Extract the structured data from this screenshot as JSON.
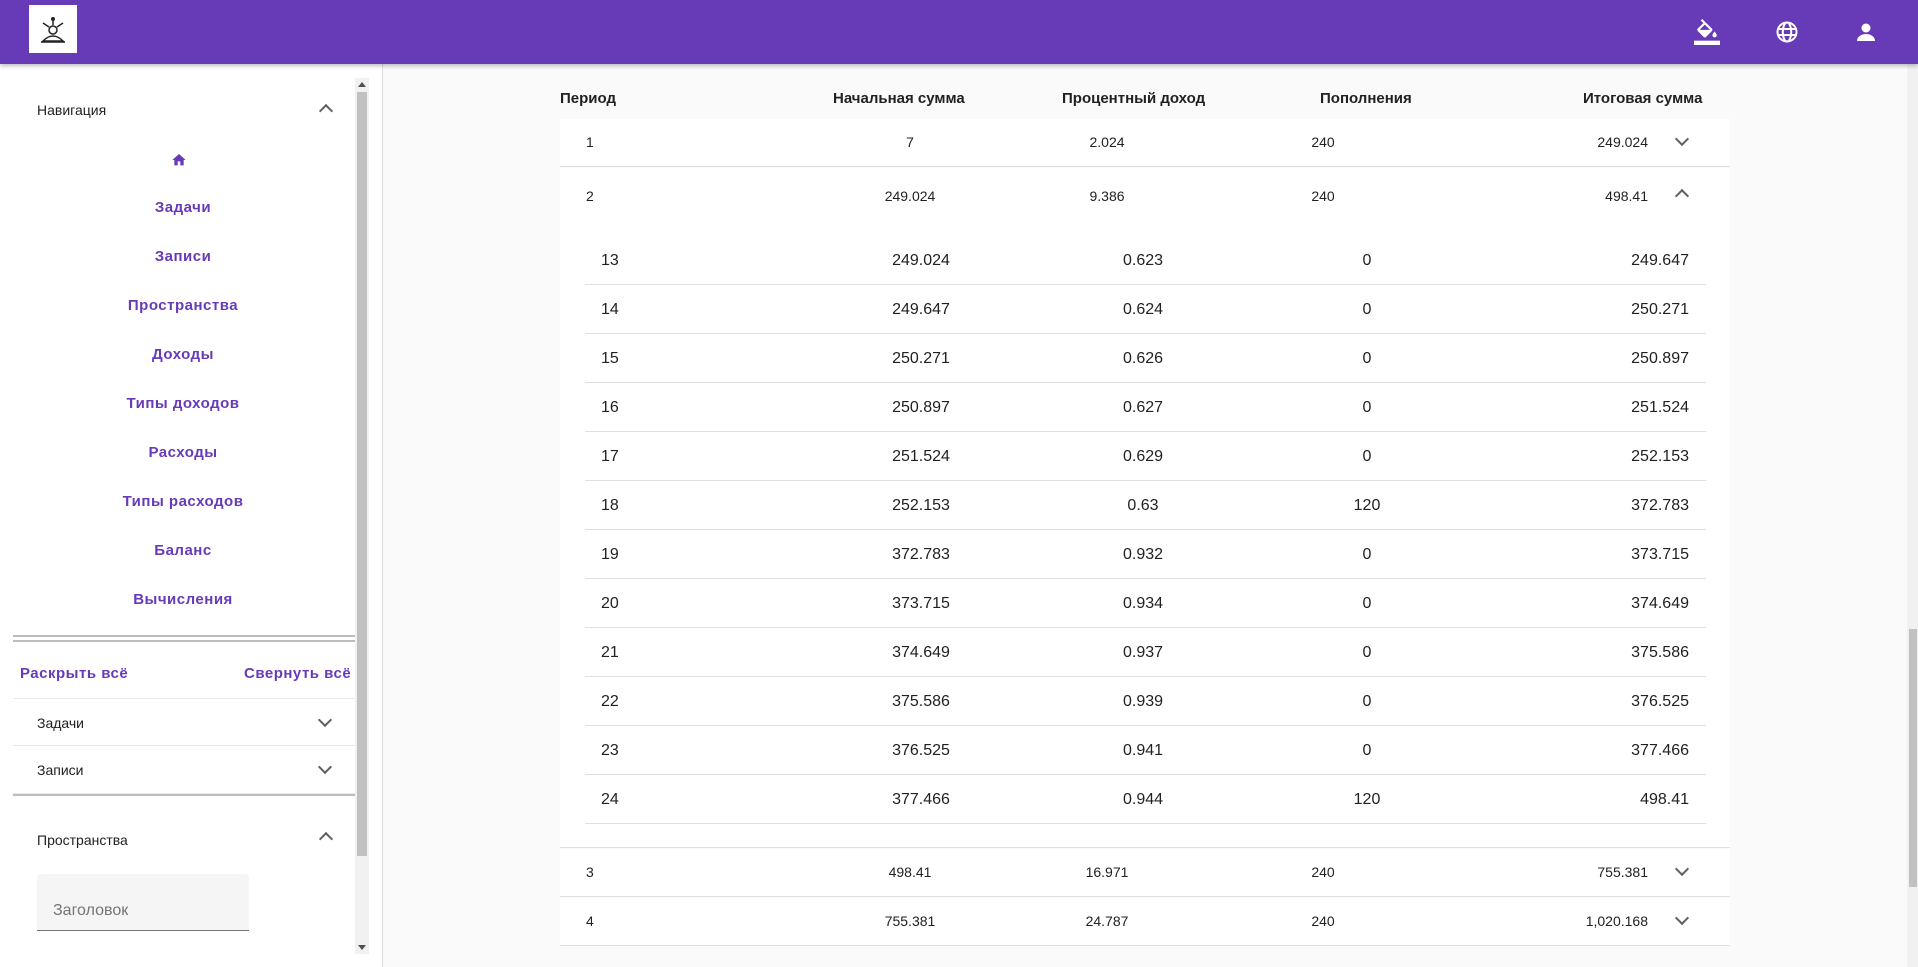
{
  "app": {
    "logo_icon": "app-logo-icon",
    "top_icons": [
      "paint-bucket-icon",
      "globe-icon",
      "account-icon"
    ],
    "accent": "#673ab7"
  },
  "sidebar": {
    "nav_title": "Навигация",
    "home_icon": "home-icon",
    "items": [
      "Задачи",
      "Записи",
      "Пространства",
      "Доходы",
      "Типы доходов",
      "Расходы",
      "Типы расходов",
      "Баланс",
      "Вычисления"
    ],
    "expand_all": "Раскрыть всё",
    "collapse_all": "Свернуть всё",
    "panels": [
      "Задачи",
      "Записи"
    ],
    "spaces_title": "Пространства",
    "title_placeholder": "Заголовок"
  },
  "table": {
    "headers": [
      "Период",
      "Начальная сумма",
      "Процентный доход",
      "Пополнения",
      "Итоговая сумма"
    ],
    "rows": [
      {
        "period": "1",
        "start": "7",
        "interest": "2.024",
        "deposits": "240",
        "total": "249.024",
        "expanded": false
      },
      {
        "period": "2",
        "start": "249.024",
        "interest": "9.386",
        "deposits": "240",
        "total": "498.41",
        "expanded": true
      },
      {
        "period": "3",
        "start": "498.41",
        "interest": "16.971",
        "deposits": "240",
        "total": "755.381",
        "expanded": false
      },
      {
        "period": "4",
        "start": "755.381",
        "interest": "24.787",
        "deposits": "240",
        "total": "1,020.168",
        "expanded": false
      }
    ],
    "subrows": [
      {
        "period": "13",
        "start": "249.024",
        "interest": "0.623",
        "deposits": "0",
        "total": "249.647"
      },
      {
        "period": "14",
        "start": "249.647",
        "interest": "0.624",
        "deposits": "0",
        "total": "250.271"
      },
      {
        "period": "15",
        "start": "250.271",
        "interest": "0.626",
        "deposits": "0",
        "total": "250.897"
      },
      {
        "period": "16",
        "start": "250.897",
        "interest": "0.627",
        "deposits": "0",
        "total": "251.524"
      },
      {
        "period": "17",
        "start": "251.524",
        "interest": "0.629",
        "deposits": "0",
        "total": "252.153"
      },
      {
        "period": "18",
        "start": "252.153",
        "interest": "0.63",
        "deposits": "120",
        "total": "372.783"
      },
      {
        "period": "19",
        "start": "372.783",
        "interest": "0.932",
        "deposits": "0",
        "total": "373.715"
      },
      {
        "period": "20",
        "start": "373.715",
        "interest": "0.934",
        "deposits": "0",
        "total": "374.649"
      },
      {
        "period": "21",
        "start": "374.649",
        "interest": "0.937",
        "deposits": "0",
        "total": "375.586"
      },
      {
        "period": "22",
        "start": "375.586",
        "interest": "0.939",
        "deposits": "0",
        "total": "376.525"
      },
      {
        "period": "23",
        "start": "376.525",
        "interest": "0.941",
        "deposits": "0",
        "total": "377.466"
      },
      {
        "period": "24",
        "start": "377.466",
        "interest": "0.944",
        "deposits": "120",
        "total": "498.41"
      }
    ]
  }
}
